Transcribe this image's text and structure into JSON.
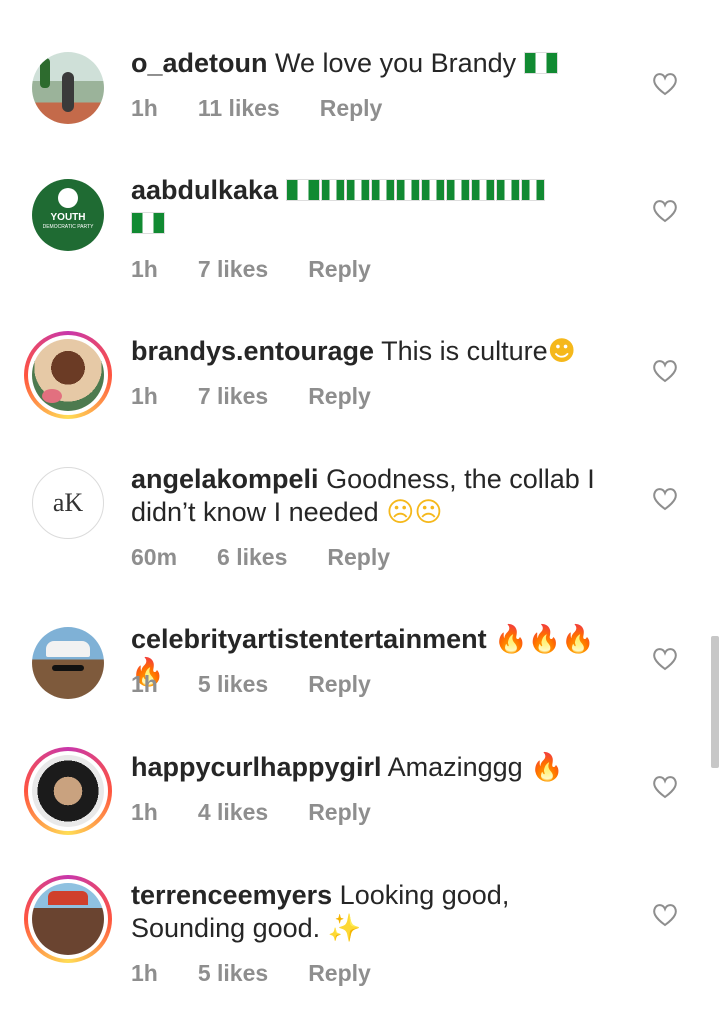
{
  "comments": [
    {
      "username": "o_adetoun",
      "text": "We love you Brandy",
      "time": "1h",
      "likes": "11 likes",
      "reply": "Reply"
    },
    {
      "username": "aabdulkaka",
      "text": "",
      "time": "1h",
      "likes": "7 likes",
      "reply": "Reply",
      "avatar_text": "YOUTH",
      "avatar_sub": "DEMOCRATIC PARTY"
    },
    {
      "username": "brandys.entourage",
      "text": "This is culture",
      "time": "1h",
      "likes": "7 likes",
      "reply": "Reply"
    },
    {
      "username": "angelakompeli",
      "text": "Goodness, the collab I didn’t know I needed",
      "time": "60m",
      "likes": "6 likes",
      "reply": "Reply",
      "avatar_text": "aK"
    },
    {
      "username": "celebrityartistentertainment",
      "text": "",
      "time": "1h",
      "likes": "5 likes",
      "reply": "Reply"
    },
    {
      "username": "happycurlhappygirl",
      "text": "Amazinggg",
      "time": "1h",
      "likes": "4 likes",
      "reply": "Reply"
    },
    {
      "username": "terrenceemyers",
      "text": "Looking good, Sounding good.",
      "time": "1h",
      "likes": "5 likes",
      "reply": "Reply"
    }
  ],
  "icons": {
    "like": "heart-outline-icon",
    "flag": "nigeria-flag-icon",
    "heart_eyes": "heart-eyes-emoji",
    "crying": "crying-emoji",
    "fire": "fire-emoji",
    "sparkles": "sparkles-emoji"
  },
  "colors": {
    "username": "#262626",
    "meta": "#8e8e8e",
    "story_ring": "#ff543e"
  }
}
